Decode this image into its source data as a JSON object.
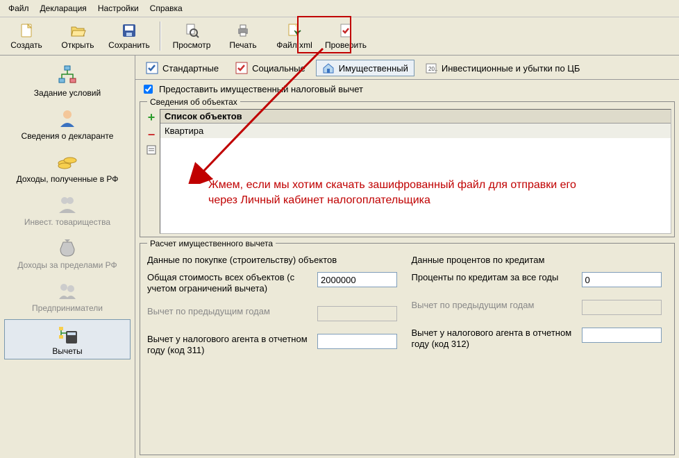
{
  "menu": {
    "file": "Файл",
    "decl": "Декларация",
    "settings": "Настройки",
    "help": "Справка"
  },
  "toolbar": {
    "create": "Создать",
    "open": "Открыть",
    "save": "Сохранить",
    "preview": "Просмотр",
    "print": "Печать",
    "xml": "Файл xml",
    "check": "Проверить"
  },
  "sidebar": {
    "items": [
      "Задание условий",
      "Сведения о декларанте",
      "Доходы, полученные в РФ",
      "Инвест. товарищества",
      "Доходы за пределами РФ",
      "Предприниматели",
      "Вычеты"
    ]
  },
  "tabs": {
    "standard": "Стандартные",
    "social": "Социальные",
    "property": "Имущественный",
    "invest": "Инвестиционные и убытки по ЦБ"
  },
  "checkbox": "Предоставить имущественный налоговый вычет",
  "objects": {
    "legend": "Сведения об объектах",
    "list_header": "Список объектов",
    "rows": [
      "Квартира"
    ]
  },
  "calc": {
    "legend": "Расчет имущественного вычета",
    "left_head": "Данные по покупке (строительству) объектов",
    "right_head": "Данные процентов по кредитам",
    "total_cost_label": "Общая стоимость всех объектов (с учетом ограничений вычета)",
    "total_cost_value": "2000000",
    "percent_label": "Проценты по кредитам за все годы",
    "percent_value": "0",
    "prev_years_label": "Вычет по предыдущим годам",
    "agent_left_label": "Вычет у налогового агента в отчетном году (код 311)",
    "agent_right_label": "Вычет у налогового агента в отчетном году (код 312)"
  },
  "annotation": "Жмем, если мы хотим скачать зашифрованный файл для отправки его через Личный кабинет налогоплательщика"
}
